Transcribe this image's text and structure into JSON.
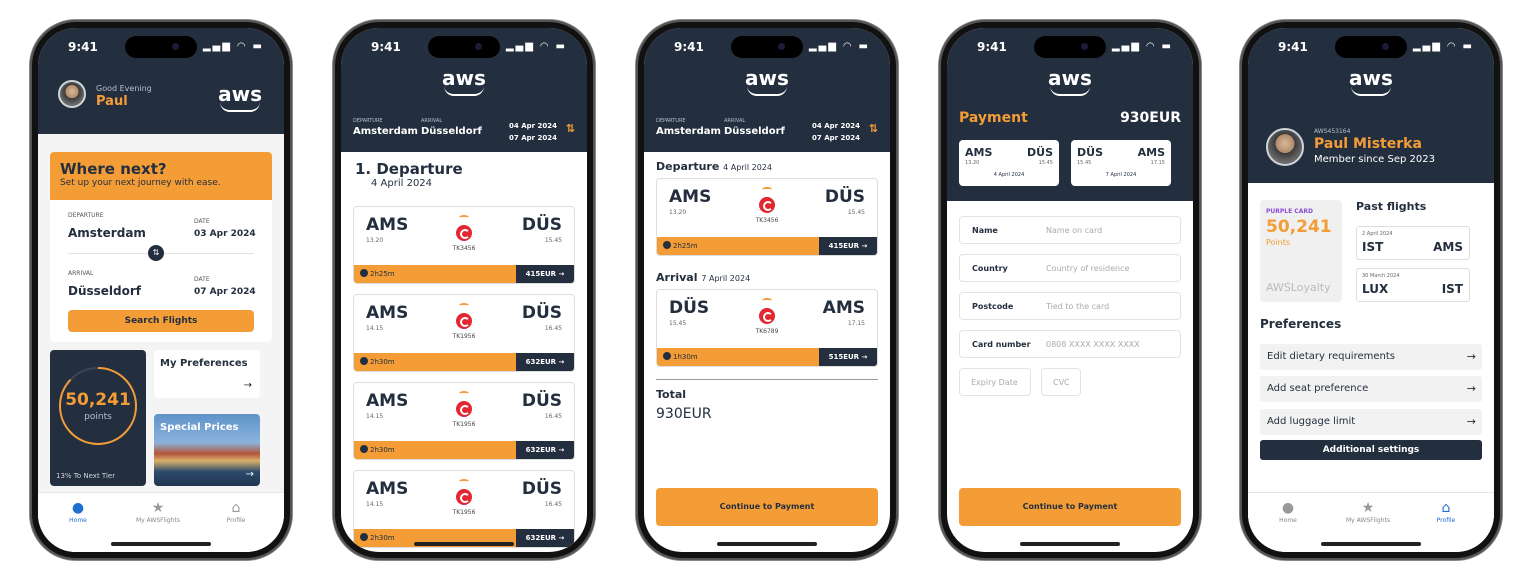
{
  "status": {
    "time": "9:41"
  },
  "brand": {
    "logo": "aws"
  },
  "home": {
    "greeting": "Good Evening",
    "name": "Paul",
    "card_title": "Where next?",
    "card_sub": "Set up your next journey with ease.",
    "departure_label": "DEPARTURE",
    "departure_city": "Amsterdam",
    "departure_date_label": "DATE",
    "departure_date": "03 Apr 2024",
    "arrival_label": "ARRIVAL",
    "arrival_city": "Düsseldorf",
    "arrival_date_label": "DATE",
    "arrival_date": "07 Apr 2024",
    "search_button": "Search Flights",
    "points_value": "50,241",
    "points_label": "points",
    "points_progress": 0.87,
    "next_tier": "13% To Next Tier",
    "preferences_title": "My Preferences",
    "special_prices": "Special Prices"
  },
  "tabs": [
    {
      "label": "Home",
      "icon": "person-icon"
    },
    {
      "label": "My AWSFlights",
      "icon": "star-icon"
    },
    {
      "label": "Profile",
      "icon": "house-icon"
    }
  ],
  "route": {
    "departure_label": "DEPARTURE",
    "departure": "Amsterdam",
    "arrival_label": "ARRIVAL",
    "arrival": "Düsseldorf",
    "date_out": "04 Apr 2024",
    "date_back": "07 Apr 2024"
  },
  "results": {
    "title": "1. Departure",
    "date": "4 April 2024",
    "flights": [
      {
        "from": "AMS",
        "from_time": "13.20",
        "to": "DÜS",
        "to_time": "15.45",
        "code": "TK3456",
        "duration": "2h25m",
        "price": "415EUR"
      },
      {
        "from": "AMS",
        "from_time": "14.15",
        "to": "DÜS",
        "to_time": "16.45",
        "code": "TK1956",
        "duration": "2h30m",
        "price": "632EUR"
      },
      {
        "from": "AMS",
        "from_time": "14.15",
        "to": "DÜS",
        "to_time": "16.45",
        "code": "TK1956",
        "duration": "2h30m",
        "price": "632EUR"
      },
      {
        "from": "AMS",
        "from_time": "14.15",
        "to": "DÜS",
        "to_time": "16.45",
        "code": "TK1956",
        "duration": "2h30m",
        "price": "632EUR"
      }
    ]
  },
  "summary": {
    "departure_title": "Departure",
    "departure_date": "4 April 2024",
    "departure_flight": {
      "from": "AMS",
      "from_time": "13.20",
      "to": "DÜS",
      "to_time": "15.45",
      "code": "TK3456",
      "duration": "2h25m",
      "price": "415EUR"
    },
    "arrival_title": "Arrival",
    "arrival_date": "7 April 2024",
    "arrival_flight": {
      "from": "DÜS",
      "from_time": "15.45",
      "to": "AMS",
      "to_time": "17.15",
      "code": "TK6789",
      "duration": "1h30m",
      "price": "515EUR"
    },
    "total_label": "Total",
    "total_value": "930EUR",
    "continue_button": "Continue to Payment"
  },
  "payment": {
    "title": "Payment",
    "amount": "930EUR",
    "out": {
      "from": "AMS",
      "from_time": "13.20",
      "to": "DÜS",
      "to_time": "15.45",
      "date": "4 April 2024"
    },
    "back": {
      "from": "DÜS",
      "from_time": "15.45",
      "to": "AMS",
      "to_time": "17.15",
      "date": "7 April 2024"
    },
    "fields": [
      {
        "label": "Name",
        "placeholder": "Name on card"
      },
      {
        "label": "Country",
        "placeholder": "Country of residence"
      },
      {
        "label": "Postcode",
        "placeholder": "Tied to the card"
      },
      {
        "label": "Card number",
        "placeholder": "0808 XXXX XXXX XXXX"
      }
    ],
    "expiry_placeholder": "Expiry Date",
    "cvc_placeholder": "CVC",
    "continue_button": "Continue to Payment"
  },
  "profile": {
    "member_id": "AWS453164",
    "name": "Paul Misterka",
    "since": "Member since Sep 2023",
    "card_tier": "PURPLE CARD",
    "points": "50,241",
    "points_label": "Points",
    "loyalty": "AWSLoyalty",
    "past_title": "Past flights",
    "past": [
      {
        "date": "2 April 2024",
        "from": "IST",
        "to": "AMS"
      },
      {
        "date": "30 March 2024",
        "from": "LUX",
        "to": "IST"
      }
    ],
    "preferences_title": "Preferences",
    "preferences": [
      "Edit dietary requirements",
      "Add seat preference",
      "Add luggage limit"
    ],
    "additional": "Additional settings"
  },
  "colors": {
    "navy": "#232f3e",
    "orange": "#f49d37",
    "active_tab": "#1f6fd1"
  }
}
